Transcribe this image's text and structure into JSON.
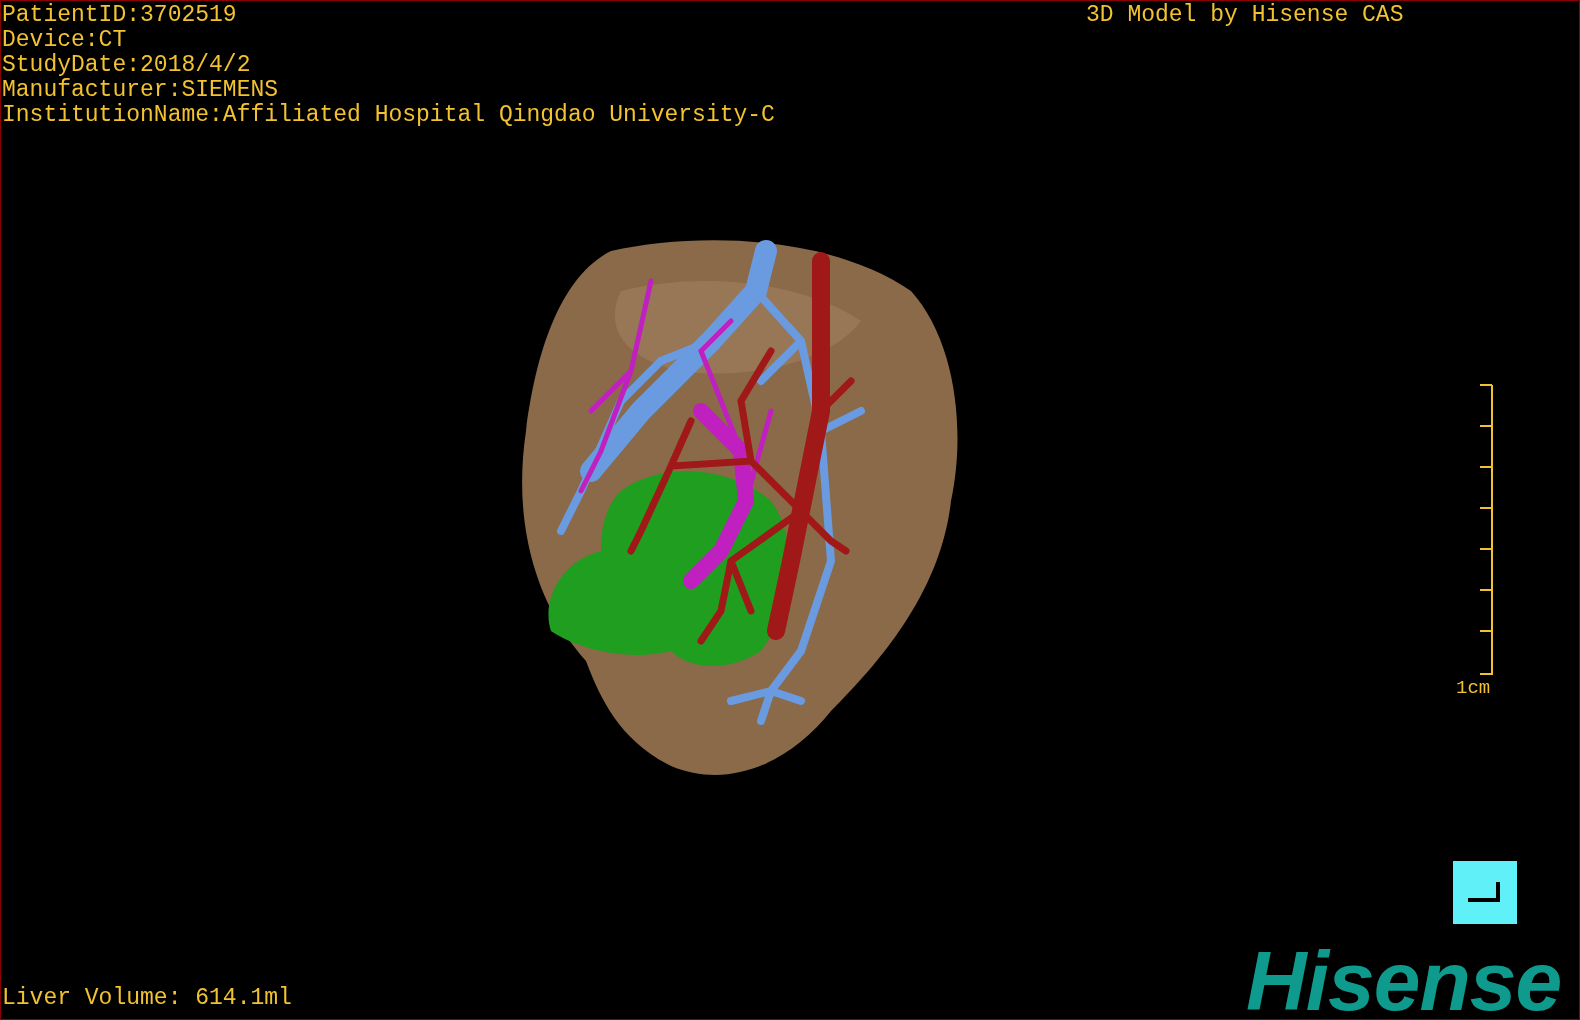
{
  "viewer": {
    "patient_info": [
      "PatientID:3702519",
      "Device:CT",
      "StudyDate:2018/4/2",
      "Manufacturer:SIEMENS",
      "InstitutionName:Affiliated Hospital Qingdao University-C"
    ],
    "model_credit": "3D Model by Hisense CAS",
    "scale_label": "1cm",
    "liver_volume": "Liver Volume: 614.1ml",
    "logo": "Hisense"
  }
}
